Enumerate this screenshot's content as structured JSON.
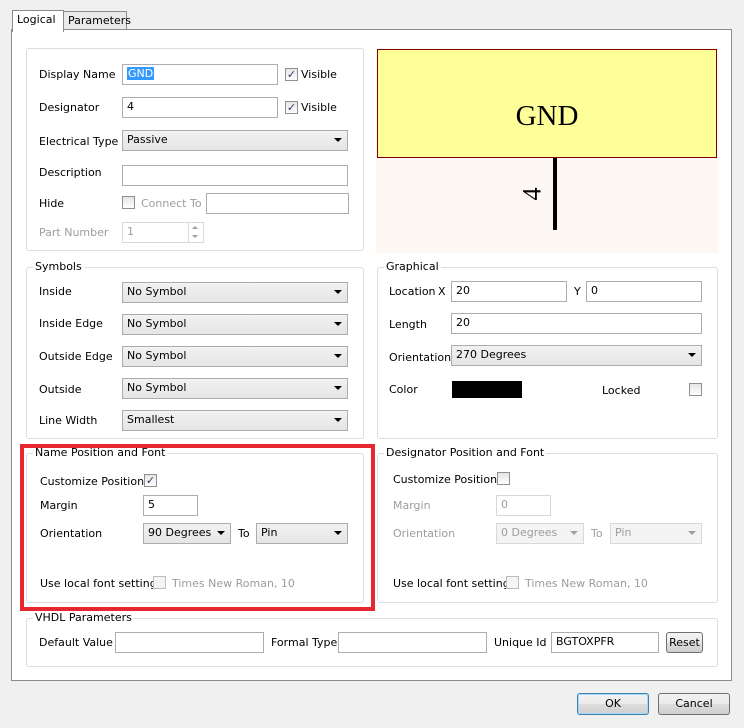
{
  "tabs": [
    {
      "label": "Logical"
    },
    {
      "label": "Parameters"
    }
  ],
  "properties": {
    "display_name_label": "Display Name",
    "display_name_value": "GND",
    "visible_label_1": "Visible",
    "designator_label": "Designator",
    "designator_value": "4",
    "visible_label_2": "Visible",
    "electrical_type_label": "Electrical Type",
    "electrical_type_value": "Passive",
    "description_label": "Description",
    "description_value": "",
    "hide_label": "Hide",
    "connect_to_label": "Connect To",
    "connect_to_value": "",
    "part_number_label": "Part Number",
    "part_number_value": "1"
  },
  "preview": {
    "name_text": "GND",
    "designator_text": "4",
    "fill_color": "#ffff99",
    "border_color": "#800000"
  },
  "symbols": {
    "title": "Symbols",
    "inside_label": "Inside",
    "inside_value": "No Symbol",
    "inside_edge_label": "Inside Edge",
    "inside_edge_value": "No Symbol",
    "outside_edge_label": "Outside Edge",
    "outside_edge_value": "No Symbol",
    "outside_label": "Outside",
    "outside_value": "No Symbol",
    "line_width_label": "Line Width",
    "line_width_value": "Smallest"
  },
  "graphical": {
    "title": "Graphical",
    "location_label": "Location",
    "x_label": "X",
    "x_value": "20",
    "y_label": "Y",
    "y_value": "0",
    "length_label": "Length",
    "length_value": "20",
    "orientation_label": "Orientation",
    "orientation_value": "270 Degrees",
    "color_label": "Color",
    "color_value": "#000000",
    "locked_label": "Locked"
  },
  "name_position": {
    "title": "Name Position and Font",
    "customize_label": "Customize Position",
    "margin_label": "Margin",
    "margin_value": "5",
    "orientation_label": "Orientation",
    "orientation_value": "90 Degrees",
    "to_label": "To",
    "to_value": "Pin",
    "font_label": "Use local font setting",
    "font_value": "Times New Roman, 10",
    "highlight_color": "#e8262e"
  },
  "designator_position": {
    "title": "Designator Position and Font",
    "customize_label": "Customize Position",
    "margin_label": "Margin",
    "margin_value": "0",
    "orientation_label": "Orientation",
    "orientation_value": "0 Degrees",
    "to_label": "To",
    "to_value": "Pin",
    "font_label": "Use local font setting",
    "font_value": "Times New Roman, 10"
  },
  "vhdl": {
    "title": "VHDL Parameters",
    "default_value_label": "Default Value",
    "default_value": "",
    "formal_type_label": "Formal Type",
    "formal_type_value": "",
    "unique_id_label": "Unique Id",
    "unique_id_value": "BGTOXPFR",
    "reset_label": "Reset"
  },
  "footer": {
    "ok_label": "OK",
    "cancel_label": "Cancel"
  }
}
